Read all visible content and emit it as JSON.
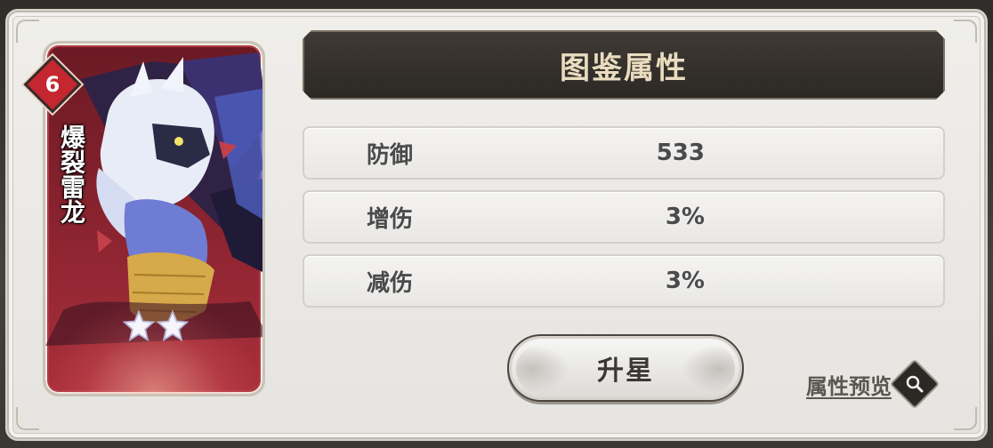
{
  "card": {
    "level": "6",
    "name": "爆裂雷龙",
    "stars": 2
  },
  "header": {
    "title": "图鉴属性"
  },
  "stats": [
    {
      "label": "防御",
      "value": "533"
    },
    {
      "label": "增伤",
      "value": "3%"
    },
    {
      "label": "减伤",
      "value": "3%"
    }
  ],
  "actions": {
    "upgrade_label": "升星",
    "preview_label": "属性预览"
  },
  "icons": {
    "preview": "magnifier-icon",
    "star": "star-icon"
  },
  "colors": {
    "card_bg": "#8c2430",
    "banner_bg": "#2c2824",
    "title_text": "#e9dcc0",
    "level_badge": "#c4272f"
  }
}
